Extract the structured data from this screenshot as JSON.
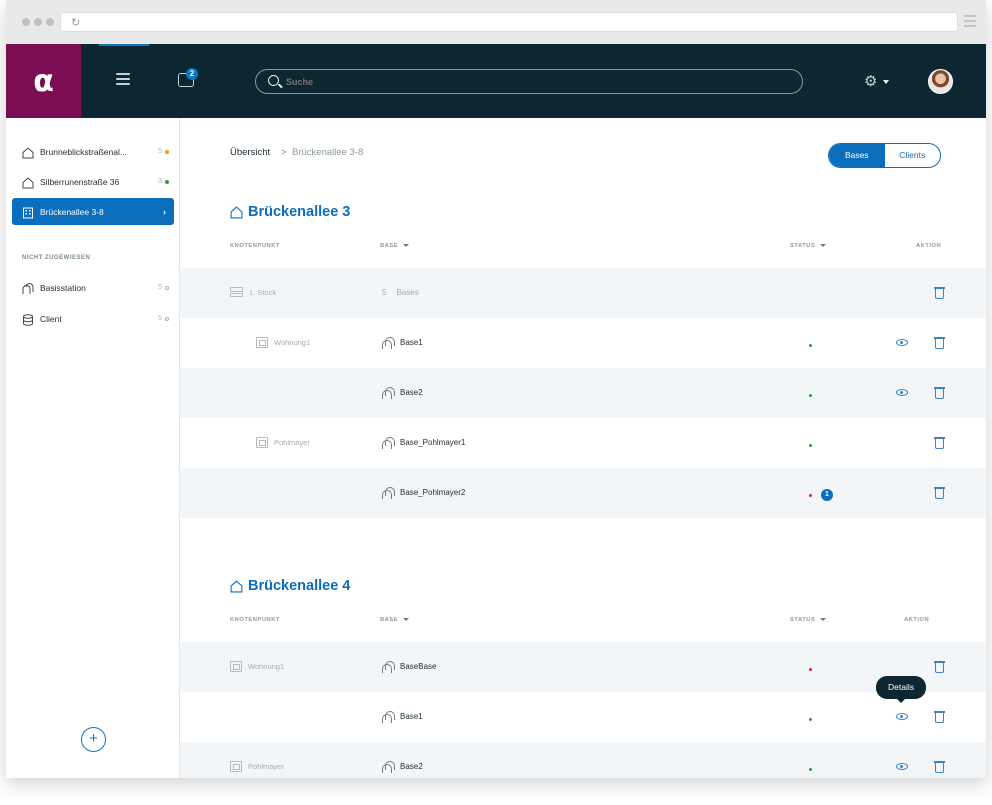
{
  "header": {
    "chat_badge": "2",
    "search_placeholder": "Suche"
  },
  "sidebar": {
    "items": [
      {
        "label": "Brunneblickstraßenal...",
        "count": "5",
        "status_color": "#f0a000"
      },
      {
        "label": "Silberrunenstraße 36",
        "count": "3",
        "status_color": "#22a33a"
      },
      {
        "label": "Brückenallee 3-8",
        "active": true
      }
    ],
    "section_label": "NICHT ZUGEWIESEN",
    "unassigned": [
      {
        "label": "Basisstation",
        "count": "5"
      },
      {
        "label": "Client",
        "count": "5"
      }
    ],
    "add_label": "+"
  },
  "breadcrumb": {
    "home": "Übersicht",
    "separator": ">",
    "current": "Brückenallee 3-8"
  },
  "toggle": {
    "bases": "Bases",
    "clients": "Clients",
    "selected": "Bases"
  },
  "columns": {
    "knotenpunkt": "KNOTENPUNKT",
    "base": "BASE",
    "status": "STATUS",
    "aktion": "AKTION"
  },
  "sections": [
    {
      "title": "Brückenallee 3",
      "rows": [
        {
          "node": "1. Stock",
          "base": "Bases",
          "base_count": "5",
          "status": null
        },
        {
          "node": "Wohnung1",
          "base": "Base1",
          "status": "#22a33a",
          "view": true
        },
        {
          "node": "",
          "base": "Base2",
          "status": "#22a33a",
          "view": true
        },
        {
          "node": "Pohlmayer",
          "base": "Base_Pohlmayer1",
          "status": "#22a33a"
        },
        {
          "node": "",
          "base": "Base_Pohlmayer2",
          "status": "#d22a2a",
          "issues": "1"
        }
      ]
    },
    {
      "title": "Brückenallee 4",
      "rows": [
        {
          "node": "Wohnung1",
          "base": "BaseBase",
          "status": "#d22a2a"
        },
        {
          "node": "",
          "base": "Base1",
          "status": "#22a33a",
          "view": true
        },
        {
          "node": "Pohlmayer",
          "base": "Base2",
          "status": "#22a33a",
          "view": true
        }
      ]
    }
  ],
  "tooltip": "Details",
  "colors": {
    "primary": "#0b6ebd",
    "header_bg": "#0c2632",
    "logo_bg": "#7b0e52",
    "row_alt": "#f3f6f8"
  }
}
